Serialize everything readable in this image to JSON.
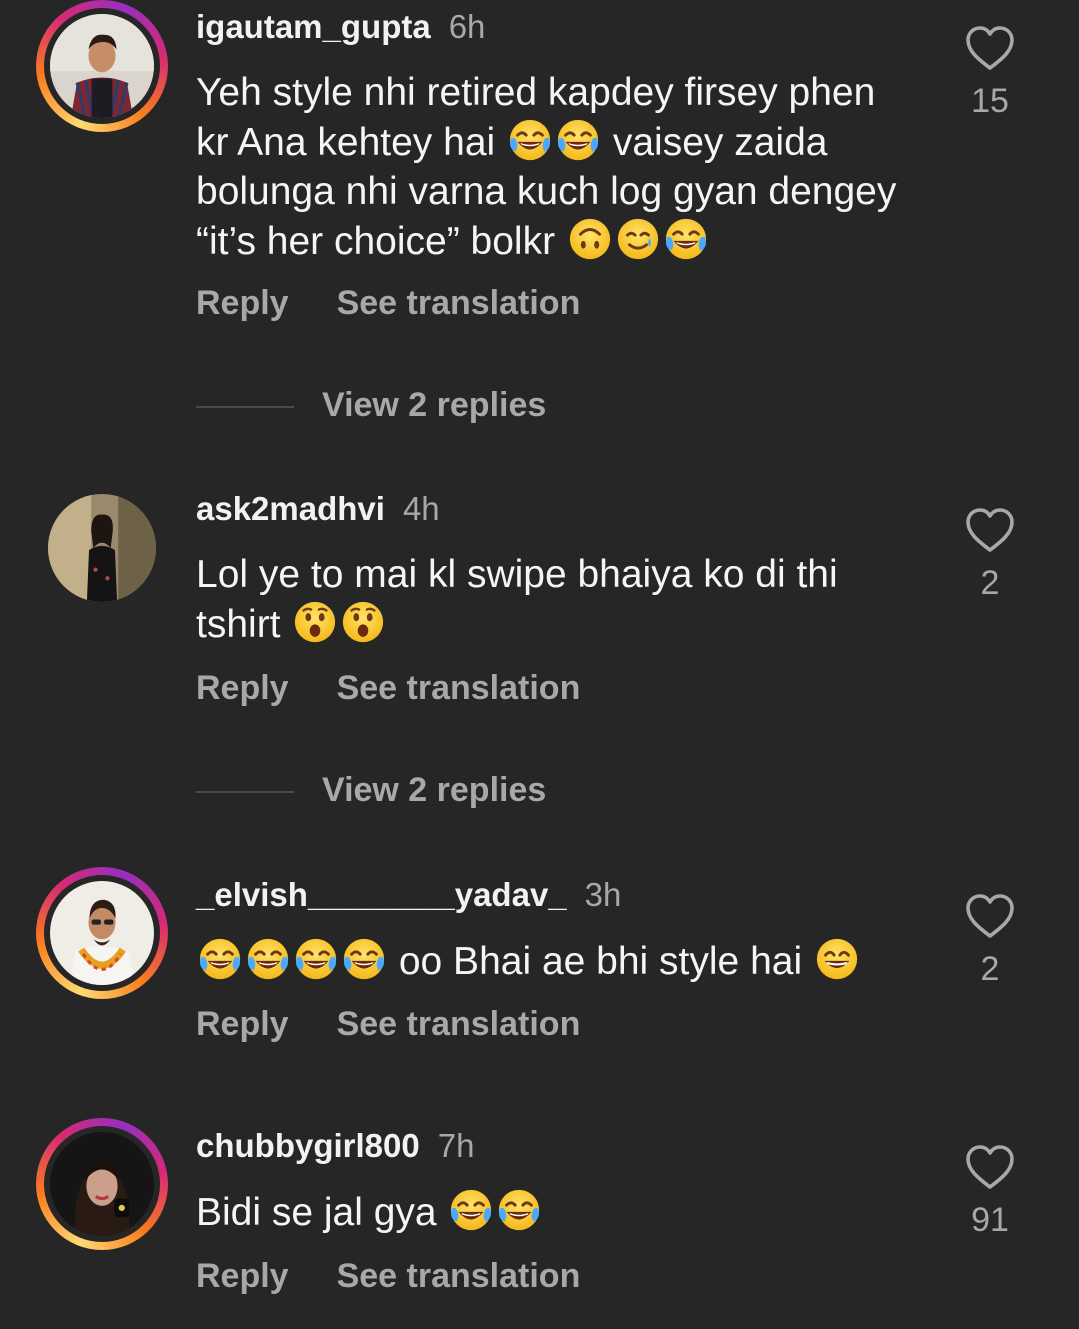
{
  "comments": [
    {
      "username": "igautam_gupta",
      "time": "6h",
      "text_parts": [
        "Yeh style nhi retired kapdey firsey phen kr Ana kehtey hai ",
        " vaisey zaida bolunga nhi varna kuch log gyan dengey “it’s her choice” bolkr "
      ],
      "likes": "15",
      "reply_label": "Reply",
      "translate_label": "See translation",
      "view_replies": "View 2 replies",
      "avatar_icon": "profile-photo-man-plaid-shirt"
    },
    {
      "username": "ask2madhvi",
      "time": "4h",
      "text_parts": [
        "Lol ye to mai kl swipe bhaiya ko di thi tshirt "
      ],
      "likes": "2",
      "reply_label": "Reply",
      "translate_label": "See translation",
      "view_replies": "View 2 replies",
      "avatar_icon": "profile-photo-woman-black-dress"
    },
    {
      "username": "_elvish________yadav_",
      "time": "3h",
      "text_parts": [
        "",
        " oo Bhai ae bhi style hai "
      ],
      "likes": "2",
      "reply_label": "Reply",
      "translate_label": "See translation",
      "avatar_icon": "profile-photo-man-garland"
    },
    {
      "username": "chubbygirl800",
      "time": "7h",
      "text_parts": [
        "Bidi se jal gya "
      ],
      "likes": "91",
      "reply_label": "Reply",
      "translate_label": "See translation",
      "avatar_icon": "profile-photo-woman-portrait"
    }
  ],
  "colors": {
    "background": "#262626",
    "primary_text": "#f5f5f5",
    "secondary_text": "#a8a8a8",
    "story_ring": [
      "#feda75",
      "#fa7e1e",
      "#d62976",
      "#962fbf"
    ]
  },
  "icons": {
    "like": "heart-outline-icon",
    "emoji_laugh": "face-with-tears-of-joy",
    "emoji_upside": "upside-down-face",
    "emoji_smile_tear": "smiling-face-with-tear",
    "emoji_surprised": "face-with-open-mouth",
    "emoji_grin": "grinning-face-with-smiling-eyes"
  }
}
